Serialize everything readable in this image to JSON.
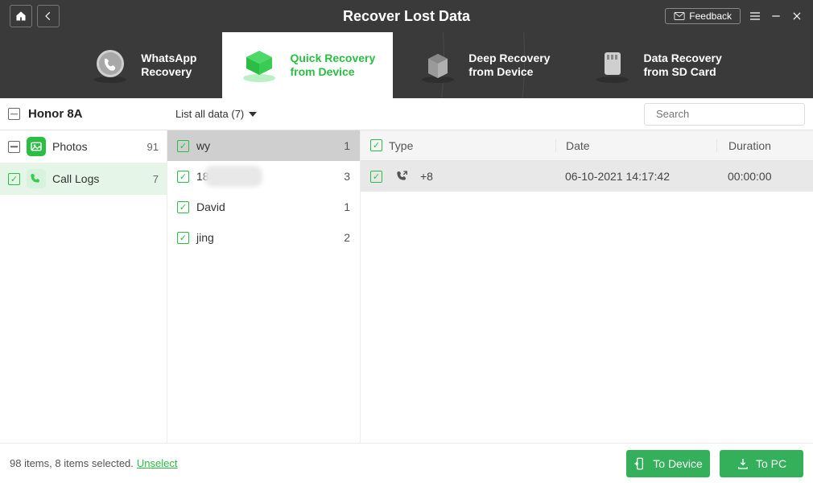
{
  "header": {
    "title": "Recover Lost Data",
    "feedback": "Feedback"
  },
  "tabs": [
    {
      "line1": "WhatsApp",
      "line2": "Recovery"
    },
    {
      "line1": "Quick Recovery",
      "line2": "from Device"
    },
    {
      "line1": "Deep Recovery",
      "line2": "from Device"
    },
    {
      "line1": "Data Recovery",
      "line2": "from SD Card"
    }
  ],
  "device_name": "Honor 8A",
  "filter_label": "List all data (7)",
  "search_placeholder": "Search",
  "sidebar": {
    "items": [
      {
        "label": "Photos",
        "count": "91"
      },
      {
        "label": "Call Logs",
        "count": "7"
      }
    ]
  },
  "contacts": [
    {
      "name": "wy",
      "count": "1"
    },
    {
      "name": "18",
      "count": "3"
    },
    {
      "name": "David",
      "count": "1"
    },
    {
      "name": "jing",
      "count": "2"
    }
  ],
  "columns": {
    "type": "Type",
    "date": "Date",
    "duration": "Duration"
  },
  "rows": [
    {
      "number_prefix": "+8",
      "date": "06-10-2021 14:17:42",
      "duration": "00:00:00"
    }
  ],
  "footer": {
    "status": "98 items, 8 items selected.",
    "unselect": "Unselect",
    "to_device": "To Device",
    "to_pc": "To PC"
  }
}
